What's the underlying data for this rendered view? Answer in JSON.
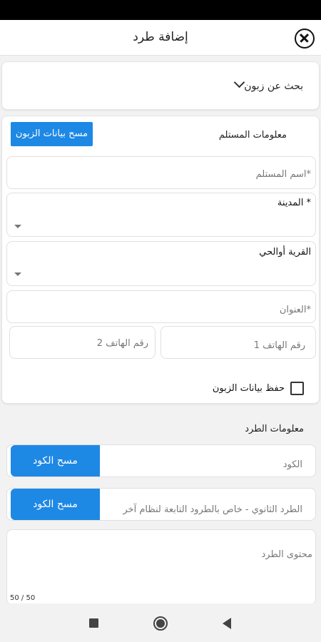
{
  "header": {
    "title": "إضافة طرد"
  },
  "customer_search": {
    "label": "بحث عن زبون"
  },
  "recipient": {
    "title": "معلومات المستلم",
    "clear_button": "مسح بيانات الزبون",
    "name_placeholder": "اسم المستلم*",
    "city_label": "المدينة *",
    "village_label": "القرية أوالحي",
    "address_placeholder": "العنوان*",
    "phone1_placeholder": "رقم الهاتف 1",
    "phone2_placeholder": "رقم الهاتف 2",
    "save_customer_label": "حفظ بيانات الزبون"
  },
  "parcel": {
    "title": "معلومات الطرد",
    "code_placeholder": "الكود",
    "scan_code_button": "مسح الكود",
    "secondary_placeholder": "الطرد الثانوي - خاص بالطرود التابعة لنظام آخر",
    "scan_code_button_2": "مسح الكود",
    "content_placeholder": "محتوى الطرد",
    "char_counter": "50 / 50"
  },
  "colors": {
    "accent": "#1e88e5",
    "background": "#f2f2f2"
  },
  "icons": [
    "close-icon",
    "chevron-down-icon",
    "dropdown-arrow-icon",
    "checkbox-icon",
    "nav-recents-icon",
    "nav-home-icon",
    "nav-back-icon"
  ]
}
